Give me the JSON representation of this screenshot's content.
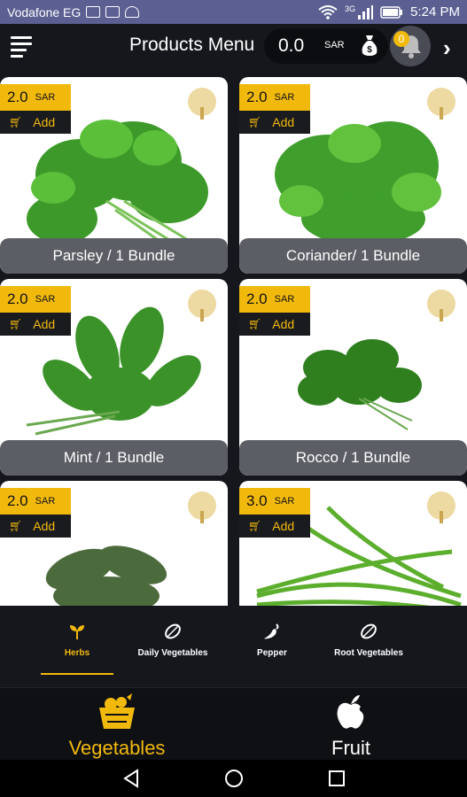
{
  "status_bar": {
    "carrier": "Vodafone EG",
    "network": "3G",
    "time": "5:24 PM"
  },
  "header": {
    "title": "Products Menu",
    "total": "0.0",
    "currency": "SAR",
    "notifications": "0"
  },
  "products": [
    {
      "price": "2.0",
      "currency": "SAR",
      "add_label": "Add",
      "name": "Parsley  / 1 Bundle"
    },
    {
      "price": "2.0",
      "currency": "SAR",
      "add_label": "Add",
      "name": "Coriander/ 1 Bundle"
    },
    {
      "price": "2.0",
      "currency": "SAR",
      "add_label": "Add",
      "name": "Mint / 1 Bundle"
    },
    {
      "price": "2.0",
      "currency": "SAR",
      "add_label": "Add",
      "name": "Rocco / 1 Bundle"
    },
    {
      "price": "2.0",
      "currency": "SAR",
      "add_label": "Add",
      "name": ""
    },
    {
      "price": "3.0",
      "currency": "SAR",
      "add_label": "Add",
      "name": ""
    }
  ],
  "subcategories": [
    {
      "label": "Herbs",
      "icon": "sprout-icon",
      "active": true
    },
    {
      "label": "Daily Vegetables",
      "icon": "leaf-icon",
      "active": false
    },
    {
      "label": "Pepper",
      "icon": "pepper-icon",
      "active": false
    },
    {
      "label": "Root Vegetables",
      "icon": "leaf-icon",
      "active": false
    }
  ],
  "main_tabs": [
    {
      "label": "Vegetables",
      "icon": "vegetable-basket-icon",
      "active": true
    },
    {
      "label": "Fruit",
      "icon": "apple-icon",
      "active": false
    }
  ],
  "colors": {
    "accent": "#f2b90d",
    "background": "#15171d",
    "status_bar": "#5b5f91"
  }
}
